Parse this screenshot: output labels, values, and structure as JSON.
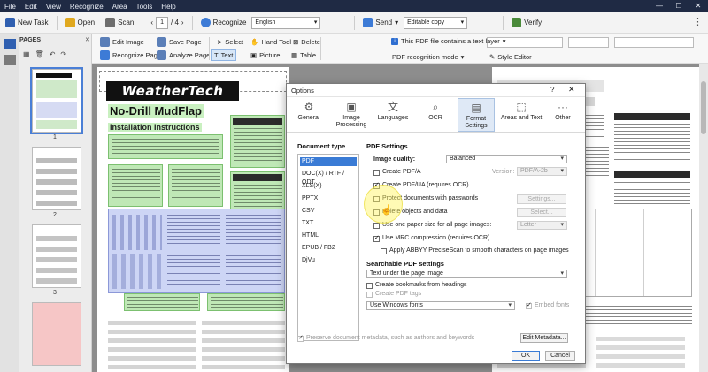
{
  "menu": [
    "File",
    "Edit",
    "View",
    "Recognize",
    "Area",
    "Tools",
    "Help"
  ],
  "toolbar": {
    "new_task": "New Task",
    "open": "Open",
    "scan": "Scan",
    "page_current": "1",
    "page_total": "/ 4",
    "recognize": "Recognize",
    "language": "English",
    "send": "Send",
    "color_mode": "Editable copy",
    "verify": "Verify"
  },
  "pages_panel": {
    "title": "PAGES",
    "thumbnails": [
      "1",
      "2",
      "3"
    ]
  },
  "toolbar2": {
    "edit_image": "Edit Image",
    "recognize_page": "Recognize Page",
    "save_page": "Save Page",
    "analyze_page": "Analyze Page",
    "select": "Select",
    "hand_tool": "Hand Tool",
    "delete": "Delete",
    "text": "Text",
    "picture": "Picture",
    "table": "Table",
    "notice": "This PDF file contains a text layer",
    "pdf_mode": "PDF recognition mode",
    "style_editor": "Style Editor"
  },
  "page_content": {
    "logo": "WeatherTech",
    "subtitle": "No-Drill MudFlap",
    "heading": "Installation Instructions"
  },
  "dialog": {
    "title": "Options",
    "help": "?",
    "close": "✕",
    "tabs": [
      {
        "icon": "gear-icon",
        "label": "General"
      },
      {
        "icon": "image-icon",
        "label": "Image Processing"
      },
      {
        "icon": "languages-icon",
        "label": "Languages"
      },
      {
        "icon": "ocr-icon",
        "label": "OCR"
      },
      {
        "icon": "format-icon",
        "label": "Format Settings"
      },
      {
        "icon": "areas-icon",
        "label": "Areas and Text"
      },
      {
        "icon": "more-icon",
        "label": "Other"
      }
    ],
    "document_type_label": "Document type",
    "document_types": [
      "PDF",
      "DOC(X) / RTF / ODT",
      "XLS(X)",
      "PPTX",
      "CSV",
      "TXT",
      "HTML",
      "EPUB / FB2",
      "DjVu"
    ],
    "pdf_settings_label": "PDF Settings",
    "image_quality_label": "Image quality:",
    "image_quality_value": "Balanced",
    "create_pdfa": "Create PDF/A",
    "version_label": "Version:",
    "version_value": "PDF/A-2b",
    "create_pdfua": "Create PDF/UA (requires OCR)",
    "protect_passwords": "Protect documents with passwords",
    "settings_button": "Settings...",
    "delete_objects": "Delete objects and data",
    "select_button": "Select...",
    "paper_size": "Use one paper size for all page images:",
    "paper_value": "Letter",
    "mrc": "Use MRC compression (requires OCR)",
    "precisescan": "Apply ABBYY PreciseScan to smooth characters on page images",
    "searchable_label": "Searchable PDF settings",
    "searchable_value": "Text under the page image",
    "bookmarks": "Create bookmarks from headings",
    "pdf_tags": "Create PDF tags",
    "fonts_value": "Use Windows fonts",
    "embed_fonts": "Embed fonts",
    "preserve_metadata": "Preserve document metadata, such as authors and keywords",
    "edit_metadata": "Edit Metadata...",
    "ok": "OK",
    "cancel": "Cancel"
  }
}
